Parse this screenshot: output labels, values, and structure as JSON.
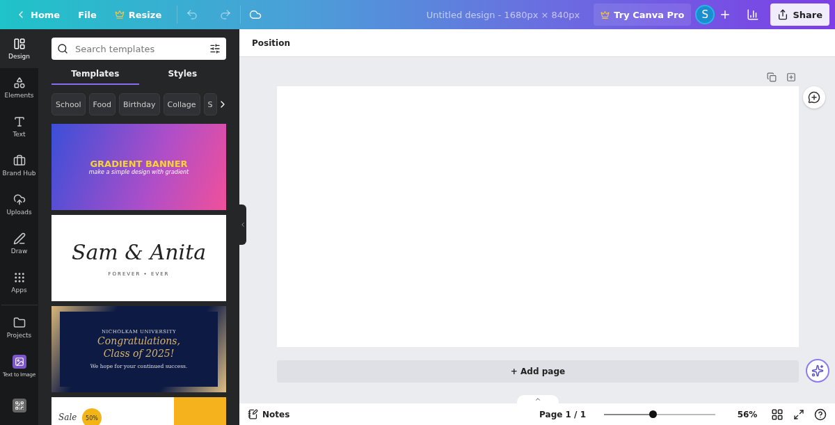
{
  "topbar": {
    "home": "Home",
    "file": "File",
    "resize": "Resize",
    "title": "Untitled design - 1680px × 840px",
    "pro": "Try Canva Pro",
    "avatar": "S",
    "share": "Share"
  },
  "rail": [
    {
      "label": "Design",
      "selected": true
    },
    {
      "label": "Elements",
      "selected": false
    },
    {
      "label": "Text",
      "selected": false
    },
    {
      "label": "Brand Hub",
      "selected": false
    },
    {
      "label": "Uploads",
      "selected": false
    },
    {
      "label": "Draw",
      "selected": false
    },
    {
      "label": "Apps",
      "selected": false
    },
    {
      "label": "Projects",
      "selected": false
    },
    {
      "label": "Text to Image",
      "selected": false
    }
  ],
  "panel": {
    "search": {
      "placeholder": "Search templates"
    },
    "tabs": [
      {
        "label": "Templates",
        "selected": true
      },
      {
        "label": "Styles",
        "selected": false
      }
    ],
    "chips": [
      "School",
      "Food",
      "Birthday",
      "Collage",
      "S"
    ],
    "templates": [
      {
        "kind": "gradient",
        "title": "GRADIENT BANNER",
        "subtitle": "make a simple design with gradient"
      },
      {
        "kind": "script",
        "title": "Sam & Anita",
        "subtitle": "FOREVER • EVER"
      },
      {
        "kind": "graduation",
        "top": "NICHOLKAM UNIVERSITY",
        "title": "Congratulations,",
        "title2": "Class of 2025!",
        "subtitle": "We hope for your continued success."
      },
      {
        "kind": "sale",
        "title": "Sale",
        "badge": "50%"
      }
    ]
  },
  "editor": {
    "toolbar": "Position",
    "add_page": "+ Add page"
  },
  "bottom": {
    "notes": "Notes",
    "page": "Page 1 / 1",
    "zoom": {
      "level": 0.44
    },
    "zoom_reading": "56%"
  }
}
